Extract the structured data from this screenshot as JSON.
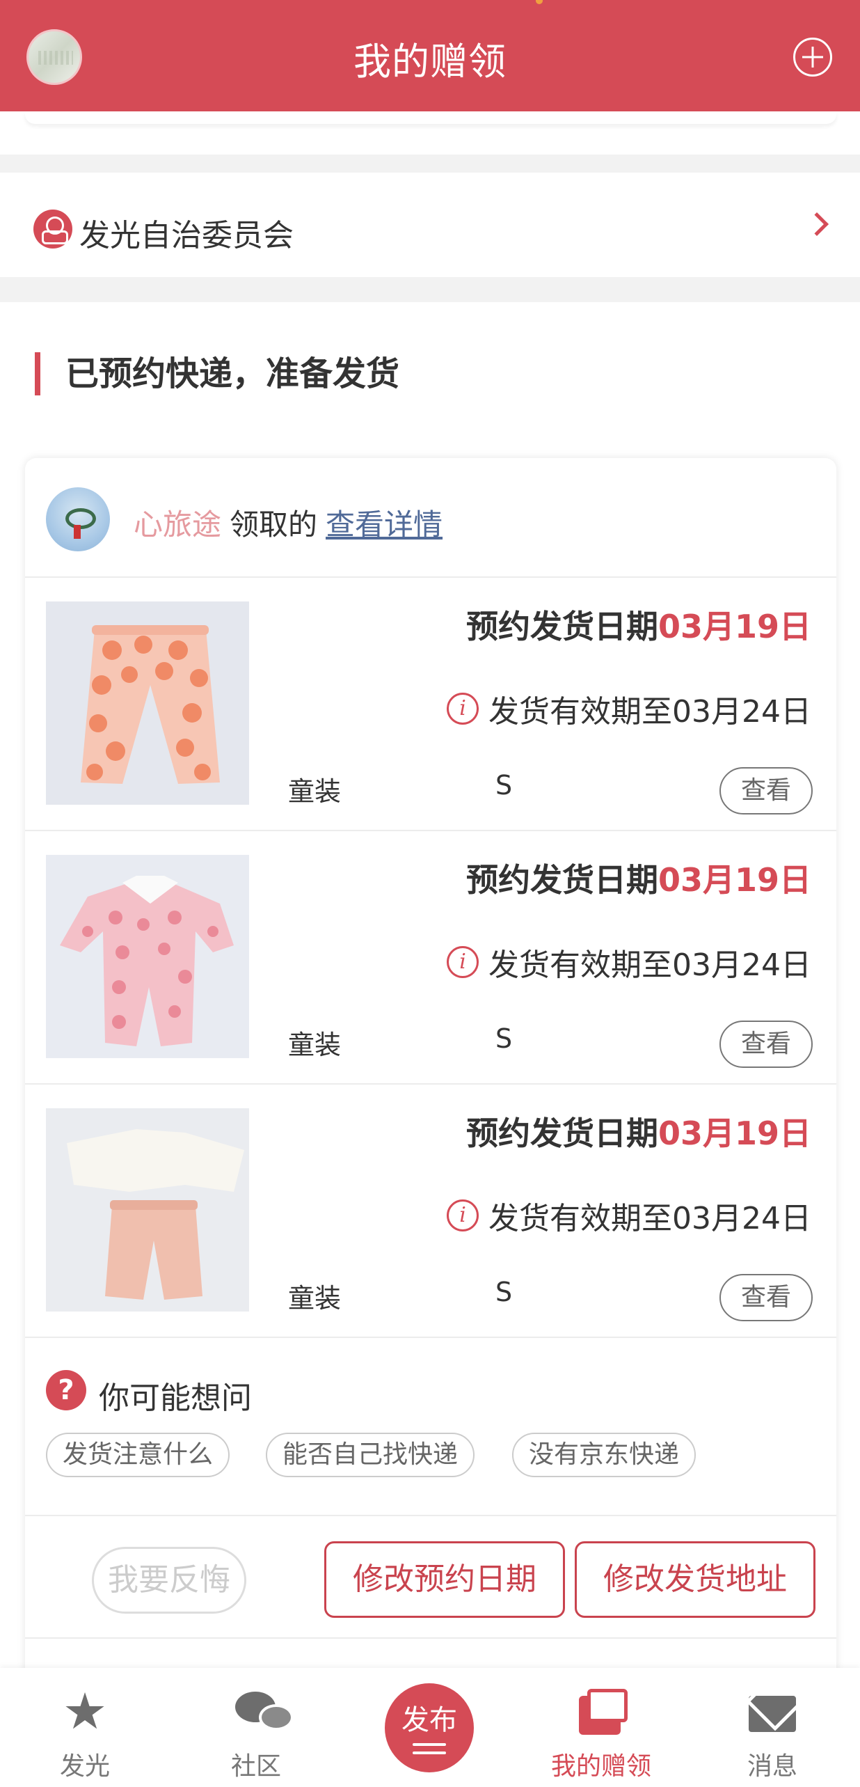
{
  "header": {
    "title": "我的赠领"
  },
  "committee": {
    "label": "发光自治委员会"
  },
  "section": {
    "title": "已预约快递，准备发货"
  },
  "claim": {
    "claimer_name": "心旅途",
    "verb": "领取的",
    "detail_link": "查看详情"
  },
  "items": [
    {
      "date_prefix": "预约发货日期",
      "date_value": "03月19日",
      "valid_text": "发货有效期至03月24日",
      "category": "童装",
      "size": "S",
      "view_label": "查看"
    },
    {
      "date_prefix": "预约发货日期",
      "date_value": "03月19日",
      "valid_text": "发货有效期至03月24日",
      "category": "童装",
      "size": "S",
      "view_label": "查看"
    },
    {
      "date_prefix": "预约发货日期",
      "date_value": "03月19日",
      "valid_text": "发货有效期至03月24日",
      "category": "童装",
      "size": "S",
      "view_label": "查看"
    }
  ],
  "faq": {
    "icon": "?",
    "title": "你可能想问",
    "chips": [
      "发货注意什么",
      "能否自己找快递",
      "没有京东快递"
    ]
  },
  "actions": {
    "regret": "我要反悔",
    "change_date": "修改预约日期",
    "change_address": "修改发货地址"
  },
  "tabbar": {
    "tabs": [
      {
        "label": "发光",
        "icon": "star-icon"
      },
      {
        "label": "社区",
        "icon": "chat-bubbles-icon"
      },
      {
        "label": "发布",
        "icon": "publish-icon"
      },
      {
        "label": "我的赠领",
        "icon": "book-icon"
      },
      {
        "label": "消息",
        "icon": "mail-icon"
      }
    ]
  },
  "colors": {
    "brand": "#d54b56",
    "claimer_name": "#e59a9f",
    "link": "#506a98"
  }
}
